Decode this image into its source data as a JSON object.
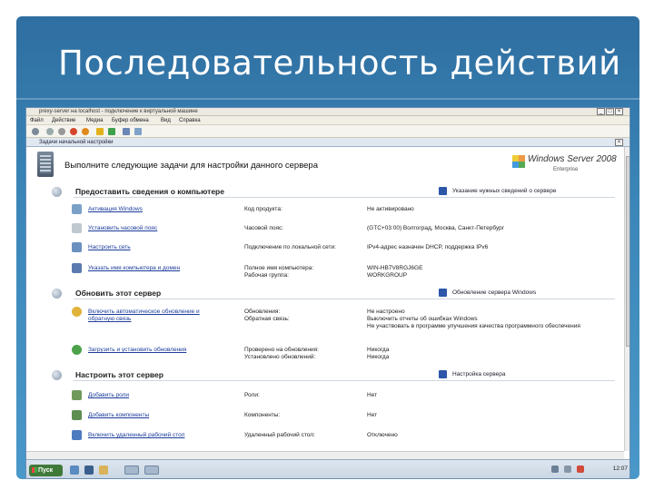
{
  "slide": {
    "title": "Последовательность действий"
  },
  "vm_window": {
    "title": "prexy-server на localhost - подключение к виртуальной машине",
    "menu": [
      "Файл",
      "Действие",
      "Медиа",
      "Буфер обмена",
      "Вид",
      "Справка"
    ],
    "buttons": {
      "minimize": "_",
      "maximize": "□",
      "close": "×"
    }
  },
  "inner_window": {
    "title": "Задачи начальной настройки"
  },
  "header": {
    "text": "Выполните следующие задачи для настройки данного сервера",
    "logo_name": "Windows Server 2008",
    "logo_edition": "Enterprise"
  },
  "sections": [
    {
      "title": "Предоставить сведения о компьютере",
      "side_link": "Указание нужных сведений о сервере",
      "rows": [
        {
          "link": "Активация Windows",
          "label": "Код продукта:",
          "value": "Не активировано"
        },
        {
          "link": "Установить часовой пояс",
          "label": "Часовой пояс:",
          "value": "(GTC+03:00) Волгоград, Москва, Санкт-Петербург"
        },
        {
          "link": "Настроить сеть",
          "label": "Подключение по локальной сети:",
          "value": "IPv4-адрес назначен DHCP, поддержка IPv6"
        },
        {
          "link": "Указать имя компьютера и домен",
          "label": "Полное имя компьютера:",
          "value": "WIN-HB7V8RGJ6GE",
          "label2": "Рабочая группа:",
          "value2": "WORKGROUP"
        }
      ]
    },
    {
      "title": "Обновить этот сервер",
      "side_link": "Обновление сервера Windows",
      "rows": [
        {
          "link": "Включить автоматическое обновление и обратную связь",
          "label": "Обновления:",
          "label2": "Обратная связь:",
          "value": "Не настроено",
          "value2": "Выключить отчеты об ошибках Windows",
          "value3": "Не участвовать в программе улучшения качества программного обеспечения"
        },
        {
          "link": "Загрузить и установить обновления",
          "label": "Проверено на обновления:",
          "label2": "Установлено обновлений:",
          "value": "Никогда",
          "value2": "Никогда"
        }
      ]
    },
    {
      "title": "Настроить этот сервер",
      "side_link": "Настройка сервера",
      "rows": [
        {
          "link": "Добавить роли",
          "label": "Роли:",
          "value": "Нет"
        },
        {
          "link": "Добавить компоненты",
          "label": "Компоненты:",
          "value": "Нет"
        },
        {
          "link": "Включить удаленный рабочий стол",
          "label": "Удаленный рабочий стол:",
          "value": "Отключено"
        }
      ]
    }
  ],
  "taskbar": {
    "start_label": "Пуск",
    "clock": "12:07"
  }
}
